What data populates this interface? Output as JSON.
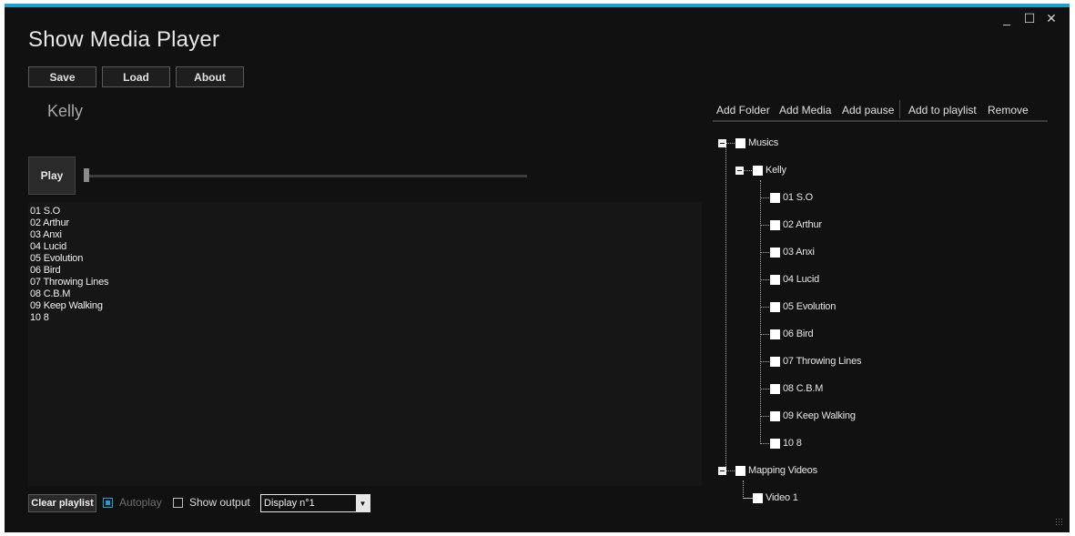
{
  "app": {
    "title": "Show Media Player"
  },
  "window_controls": {
    "minimize": "_",
    "maximize": "☐",
    "close": "✕"
  },
  "toolbar": {
    "save_label": "Save",
    "load_label": "Load",
    "about_label": "About"
  },
  "now_playing": "Kelly",
  "player": {
    "play_label": "Play",
    "seek_position": 0
  },
  "playlist": [
    "01 S.O",
    "02 Arthur",
    "03 Anxi",
    "04 Lucid",
    "05 Evolution",
    "06 Bird",
    "07 Throwing Lines",
    "08 C.B.M",
    "09 Keep Walking",
    "10 8"
  ],
  "bottom": {
    "clear_label": "Clear playlist",
    "autoplay_label": "Autoplay",
    "autoplay_checked": true,
    "show_output_label": "Show output",
    "show_output_checked": false,
    "display_value": "Display n°1"
  },
  "library_toolbar": {
    "add_folder": "Add Folder",
    "add_media": "Add Media",
    "add_pause": "Add pause",
    "add_to_playlist": "Add to playlist",
    "remove": "Remove"
  },
  "tree": {
    "root1": "Musics",
    "folder1": "Kelly",
    "tracks": [
      "01 S.O",
      "02 Arthur",
      "03 Anxi",
      "04 Lucid",
      "05 Evolution",
      "06 Bird",
      "07 Throwing Lines",
      "08 C.B.M",
      "09 Keep Walking",
      "10 8"
    ],
    "root2": "Mapping Videos",
    "video1": "Video 1"
  },
  "colors": {
    "accent": "#17a2d6",
    "background": "#111111",
    "text": "#e6e6e6"
  }
}
